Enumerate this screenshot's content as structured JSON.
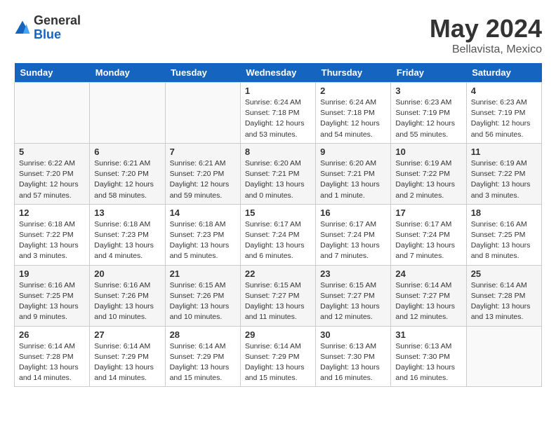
{
  "header": {
    "logo_general": "General",
    "logo_blue": "Blue",
    "month_year": "May 2024",
    "location": "Bellavista, Mexico"
  },
  "days_of_week": [
    "Sunday",
    "Monday",
    "Tuesday",
    "Wednesday",
    "Thursday",
    "Friday",
    "Saturday"
  ],
  "weeks": [
    [
      {
        "day": "",
        "sunrise": "",
        "sunset": "",
        "daylight": ""
      },
      {
        "day": "",
        "sunrise": "",
        "sunset": "",
        "daylight": ""
      },
      {
        "day": "",
        "sunrise": "",
        "sunset": "",
        "daylight": ""
      },
      {
        "day": "1",
        "sunrise": "Sunrise: 6:24 AM",
        "sunset": "Sunset: 7:18 PM",
        "daylight": "Daylight: 12 hours and 53 minutes."
      },
      {
        "day": "2",
        "sunrise": "Sunrise: 6:24 AM",
        "sunset": "Sunset: 7:18 PM",
        "daylight": "Daylight: 12 hours and 54 minutes."
      },
      {
        "day": "3",
        "sunrise": "Sunrise: 6:23 AM",
        "sunset": "Sunset: 7:19 PM",
        "daylight": "Daylight: 12 hours and 55 minutes."
      },
      {
        "day": "4",
        "sunrise": "Sunrise: 6:23 AM",
        "sunset": "Sunset: 7:19 PM",
        "daylight": "Daylight: 12 hours and 56 minutes."
      }
    ],
    [
      {
        "day": "5",
        "sunrise": "Sunrise: 6:22 AM",
        "sunset": "Sunset: 7:20 PM",
        "daylight": "Daylight: 12 hours and 57 minutes."
      },
      {
        "day": "6",
        "sunrise": "Sunrise: 6:21 AM",
        "sunset": "Sunset: 7:20 PM",
        "daylight": "Daylight: 12 hours and 58 minutes."
      },
      {
        "day": "7",
        "sunrise": "Sunrise: 6:21 AM",
        "sunset": "Sunset: 7:20 PM",
        "daylight": "Daylight: 12 hours and 59 minutes."
      },
      {
        "day": "8",
        "sunrise": "Sunrise: 6:20 AM",
        "sunset": "Sunset: 7:21 PM",
        "daylight": "Daylight: 13 hours and 0 minutes."
      },
      {
        "day": "9",
        "sunrise": "Sunrise: 6:20 AM",
        "sunset": "Sunset: 7:21 PM",
        "daylight": "Daylight: 13 hours and 1 minute."
      },
      {
        "day": "10",
        "sunrise": "Sunrise: 6:19 AM",
        "sunset": "Sunset: 7:22 PM",
        "daylight": "Daylight: 13 hours and 2 minutes."
      },
      {
        "day": "11",
        "sunrise": "Sunrise: 6:19 AM",
        "sunset": "Sunset: 7:22 PM",
        "daylight": "Daylight: 13 hours and 3 minutes."
      }
    ],
    [
      {
        "day": "12",
        "sunrise": "Sunrise: 6:18 AM",
        "sunset": "Sunset: 7:22 PM",
        "daylight": "Daylight: 13 hours and 3 minutes."
      },
      {
        "day": "13",
        "sunrise": "Sunrise: 6:18 AM",
        "sunset": "Sunset: 7:23 PM",
        "daylight": "Daylight: 13 hours and 4 minutes."
      },
      {
        "day": "14",
        "sunrise": "Sunrise: 6:18 AM",
        "sunset": "Sunset: 7:23 PM",
        "daylight": "Daylight: 13 hours and 5 minutes."
      },
      {
        "day": "15",
        "sunrise": "Sunrise: 6:17 AM",
        "sunset": "Sunset: 7:24 PM",
        "daylight": "Daylight: 13 hours and 6 minutes."
      },
      {
        "day": "16",
        "sunrise": "Sunrise: 6:17 AM",
        "sunset": "Sunset: 7:24 PM",
        "daylight": "Daylight: 13 hours and 7 minutes."
      },
      {
        "day": "17",
        "sunrise": "Sunrise: 6:17 AM",
        "sunset": "Sunset: 7:24 PM",
        "daylight": "Daylight: 13 hours and 7 minutes."
      },
      {
        "day": "18",
        "sunrise": "Sunrise: 6:16 AM",
        "sunset": "Sunset: 7:25 PM",
        "daylight": "Daylight: 13 hours and 8 minutes."
      }
    ],
    [
      {
        "day": "19",
        "sunrise": "Sunrise: 6:16 AM",
        "sunset": "Sunset: 7:25 PM",
        "daylight": "Daylight: 13 hours and 9 minutes."
      },
      {
        "day": "20",
        "sunrise": "Sunrise: 6:16 AM",
        "sunset": "Sunset: 7:26 PM",
        "daylight": "Daylight: 13 hours and 10 minutes."
      },
      {
        "day": "21",
        "sunrise": "Sunrise: 6:15 AM",
        "sunset": "Sunset: 7:26 PM",
        "daylight": "Daylight: 13 hours and 10 minutes."
      },
      {
        "day": "22",
        "sunrise": "Sunrise: 6:15 AM",
        "sunset": "Sunset: 7:27 PM",
        "daylight": "Daylight: 13 hours and 11 minutes."
      },
      {
        "day": "23",
        "sunrise": "Sunrise: 6:15 AM",
        "sunset": "Sunset: 7:27 PM",
        "daylight": "Daylight: 13 hours and 12 minutes."
      },
      {
        "day": "24",
        "sunrise": "Sunrise: 6:14 AM",
        "sunset": "Sunset: 7:27 PM",
        "daylight": "Daylight: 13 hours and 12 minutes."
      },
      {
        "day": "25",
        "sunrise": "Sunrise: 6:14 AM",
        "sunset": "Sunset: 7:28 PM",
        "daylight": "Daylight: 13 hours and 13 minutes."
      }
    ],
    [
      {
        "day": "26",
        "sunrise": "Sunrise: 6:14 AM",
        "sunset": "Sunset: 7:28 PM",
        "daylight": "Daylight: 13 hours and 14 minutes."
      },
      {
        "day": "27",
        "sunrise": "Sunrise: 6:14 AM",
        "sunset": "Sunset: 7:29 PM",
        "daylight": "Daylight: 13 hours and 14 minutes."
      },
      {
        "day": "28",
        "sunrise": "Sunrise: 6:14 AM",
        "sunset": "Sunset: 7:29 PM",
        "daylight": "Daylight: 13 hours and 15 minutes."
      },
      {
        "day": "29",
        "sunrise": "Sunrise: 6:14 AM",
        "sunset": "Sunset: 7:29 PM",
        "daylight": "Daylight: 13 hours and 15 minutes."
      },
      {
        "day": "30",
        "sunrise": "Sunrise: 6:13 AM",
        "sunset": "Sunset: 7:30 PM",
        "daylight": "Daylight: 13 hours and 16 minutes."
      },
      {
        "day": "31",
        "sunrise": "Sunrise: 6:13 AM",
        "sunset": "Sunset: 7:30 PM",
        "daylight": "Daylight: 13 hours and 16 minutes."
      },
      {
        "day": "",
        "sunrise": "",
        "sunset": "",
        "daylight": ""
      }
    ]
  ]
}
